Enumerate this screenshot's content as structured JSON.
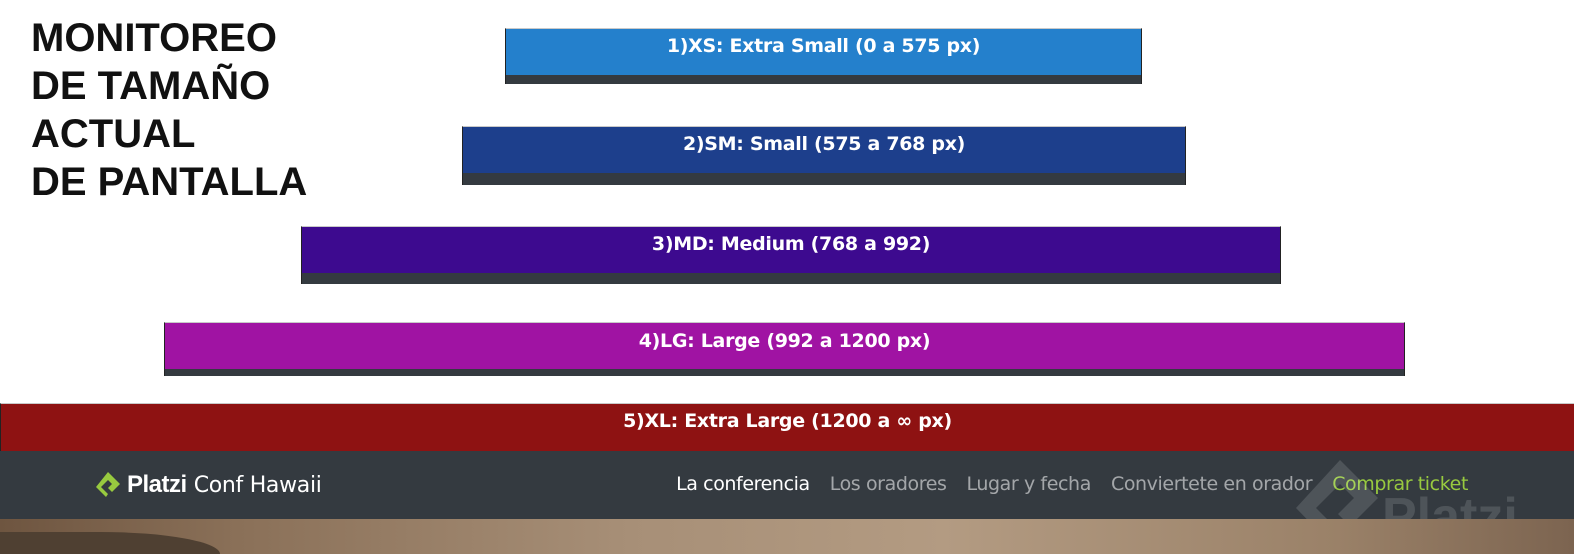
{
  "title_lines": [
    "MONITOREO",
    "DE TAMAÑO",
    "ACTUAL",
    "DE PANTALLA"
  ],
  "breakpoints": {
    "xs": {
      "label": "1)XS: Extra Small (0 a 575 px)",
      "color": "#2480cc"
    },
    "sm": {
      "label": "2)SM: Small (575 a 768 px)",
      "color": "#1d3f8c"
    },
    "md": {
      "label": "3)MD: Medium (768 a 992)",
      "color": "#3d0a8f"
    },
    "lg": {
      "label": "4)LG: Large (992 a 1200 px)",
      "color": "#a013a3"
    },
    "xl": {
      "label": "5)XL: Extra Large (1200 a ∞ px)",
      "color": "#8e1212"
    }
  },
  "navbar": {
    "brand_platzi": "Platzi",
    "brand_rest": "Conf Hawaii",
    "links": [
      {
        "label": "La conferencia"
      },
      {
        "label": "Los oradores"
      },
      {
        "label": "Lugar y fecha"
      },
      {
        "label": "Conviertete en orador"
      },
      {
        "label": "Comprar ticket"
      }
    ]
  },
  "watermark": {
    "text": "Platzi"
  },
  "colors": {
    "navbar_bg": "#343a40",
    "brand_green": "#98ca3f"
  }
}
